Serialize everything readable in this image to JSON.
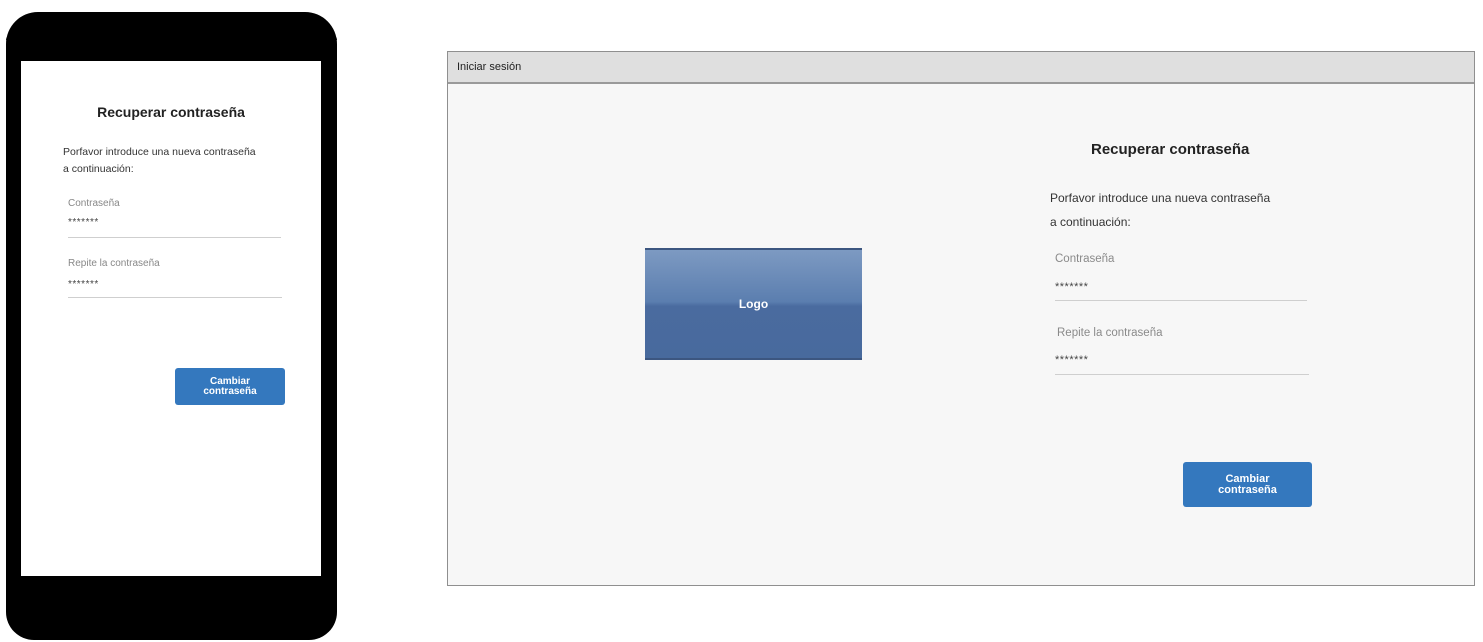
{
  "mobile": {
    "title": "Recuperar contraseña",
    "intro_line1": "Porfavor introduce una nueva contraseña",
    "intro_line2": "a continuación:",
    "password_label": "Contraseña",
    "password_value": "*******",
    "repeat_label": "Repite la contraseña",
    "repeat_value": "*******",
    "submit_label": "Cambiar contraseña"
  },
  "desktop": {
    "window_title": "Iniciar sesión",
    "logo_label": "Logo",
    "title": "Recuperar contraseña",
    "intro_line1": "Porfavor introduce una nueva contraseña",
    "intro_line2": "a continuación:",
    "password_label": "Contraseña",
    "password_value": "*******",
    "repeat_label": "Repite la contraseña",
    "repeat_value": "*******",
    "submit_label": "Cambiar contraseña"
  },
  "colors": {
    "accent": "#3478be",
    "logo": "#5b7eaf",
    "titlebar": "#dfdfdf",
    "window_background": "#f7f7f7",
    "phone_frame": "#000000"
  }
}
